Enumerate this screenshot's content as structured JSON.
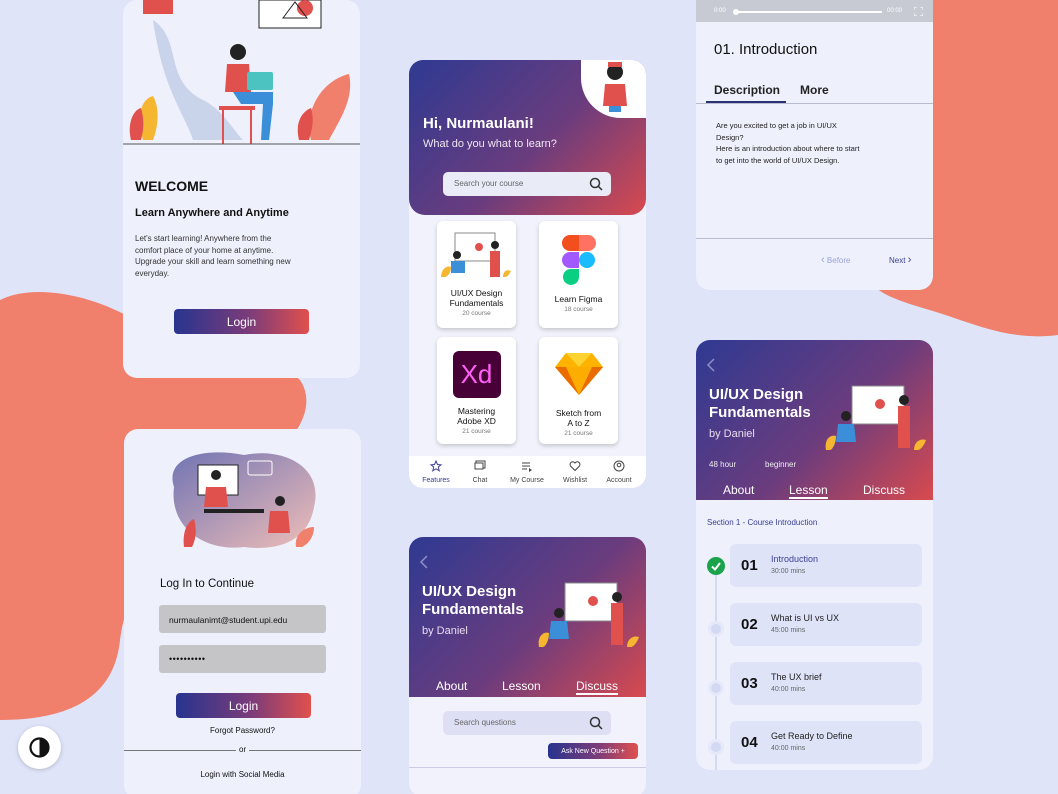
{
  "colors": {
    "bg": "#dfe4f9",
    "coral": "#f07f6c",
    "accent_blue": "#28348f",
    "accent_red": "#e0504d"
  },
  "welcome": {
    "title": "WELCOME",
    "subtitle": "Learn Anywhere and Anytime",
    "body": "Let's start learning!  Anywhere from the comfort place of your home at anytime. Upgrade your skill and learn something new everyday.",
    "login_label": "Login"
  },
  "login": {
    "heading": "Log In to Continue",
    "email_value": "nurmaulanimt@student.upi.edu",
    "password_value": "••••••••••",
    "login_label": "Login",
    "forgot": "Forgot Password?",
    "or": "or",
    "social": "Login with Social Media"
  },
  "home": {
    "greeting": "Hi, Nurmaulani!",
    "question": "What do you what to learn?",
    "search_placeholder": "Search your course",
    "courses": [
      {
        "title": "UI/UX Design Fundamentals",
        "count": "20 course"
      },
      {
        "title": "Learn Figma",
        "count": "18 course"
      },
      {
        "title": "Mastering Adobe XD",
        "count": "21 course"
      },
      {
        "title": "Sketch from A to Z",
        "count": "21 course"
      }
    ],
    "xd_label": "Xd",
    "nav": [
      {
        "label": "Features"
      },
      {
        "label": "Chat"
      },
      {
        "label": "My Course"
      },
      {
        "label": "Wishlist"
      },
      {
        "label": "Account"
      }
    ]
  },
  "discuss": {
    "title": "UI/UX Design Fundamentals",
    "author": "by Daniel",
    "tabs": [
      "About",
      "Lesson",
      "Discuss"
    ],
    "search_placeholder": "Search questions",
    "ask_label": "Ask New Question  +"
  },
  "video": {
    "time_start": "0:00",
    "time_end": "00:00",
    "title": "01. Introduction",
    "tabs": [
      "Description",
      "More"
    ],
    "description": "Are you excited to get a job in UI/UX Design?\nHere is an introduction about where to start to get into the world of UI/UX Design.",
    "before": "Before",
    "next": "Next"
  },
  "lesson": {
    "title": "UI/UX Design Fundamentals",
    "author": "by Daniel",
    "hours": "48 hour",
    "level": "beginner",
    "tabs": [
      "About",
      "Lesson",
      "Discuss"
    ],
    "section": "Section 1 - Course Introduction",
    "items": [
      {
        "num": "01",
        "title": "Introduction",
        "mins": "30:00 mins"
      },
      {
        "num": "02",
        "title": "What is UI vs UX",
        "mins": "45:00 mins"
      },
      {
        "num": "03",
        "title": "The UX brief",
        "mins": "40:00 mins"
      },
      {
        "num": "04",
        "title": "Get Ready to Define",
        "mins": "40:00 mins"
      }
    ]
  }
}
